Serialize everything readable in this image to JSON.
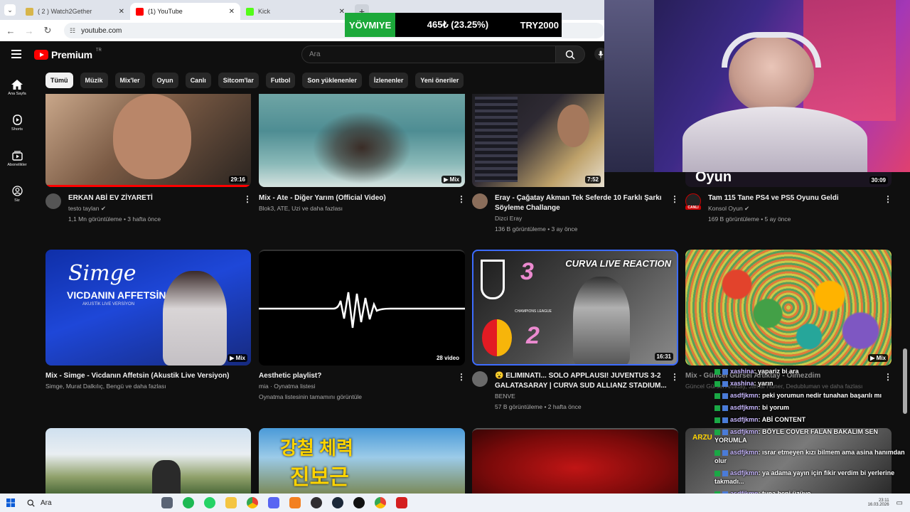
{
  "browser": {
    "tabs": [
      {
        "title": "( 2 ) Watch2Gether",
        "color": "#d7b54a",
        "active": false
      },
      {
        "title": "(1) YouTube",
        "color": "#ff0000",
        "active": true
      },
      {
        "title": "Kick",
        "color": "#53fc18",
        "active": false
      }
    ],
    "address": "youtube.com"
  },
  "ticker": {
    "label": "YÖVMIYE",
    "value": "465₺ (23.25%)",
    "currency": "TRY2000"
  },
  "youtube": {
    "logo_text": "Premium",
    "logo_region": "TR",
    "search_placeholder": "Ara",
    "leftnav": [
      {
        "label": "Ana Sayfa",
        "icon": "home-icon"
      },
      {
        "label": "Shorts",
        "icon": "shorts-icon"
      },
      {
        "label": "Abonelikler",
        "icon": "subscriptions-icon"
      },
      {
        "label": "Siz",
        "icon": "you-icon"
      }
    ],
    "chips": [
      "Tümü",
      "Müzik",
      "Mix'ler",
      "Oyun",
      "Canlı",
      "Sitcom'lar",
      "Futbol",
      "Son yüklenenler",
      "İzlenenler",
      "Yeni öneriler"
    ],
    "videos": [
      {
        "title": "ERKAN ABİ EV ZİYARETİ",
        "title2": "",
        "channel": "testo taylan",
        "verified": true,
        "stats": "1,1 Mn görüntüleme • 3 hafta önce",
        "badge": "29:16"
      },
      {
        "title": "Mix - Ate - Diğer Yarım (Official Video)",
        "title2": "",
        "channel": "Blok3, ATE, Uzi ve daha fazlası",
        "verified": false,
        "stats": "",
        "badge": "▶ Mix"
      },
      {
        "title": "Eray - Çağatay Akman Tek Seferde 10 Farklı Şarkı",
        "title2": "Söyleme Challange",
        "channel": "Dizci Eray",
        "verified": false,
        "stats": "136 B görüntüleme • 3 ay önce",
        "badge": "7:52"
      },
      {
        "title": "Tam 115 Tane PS4 ve PS5 Oyunu Geldi",
        "title2": "",
        "channel": "Konsol Oyun",
        "verified": true,
        "stats": "169 B görüntüleme • 5 ay önce",
        "badge": "30:09"
      },
      {
        "title": "Mix - Simge - Vicdanın Affetsin (Akustik Live Versiyon)",
        "title2": "",
        "channel": "Simge, Murat Dalkılıç, Bengü ve daha fazlası",
        "verified": false,
        "stats": "",
        "badge": "▶ Mix"
      },
      {
        "title": "Aesthetic playlist?",
        "title2": "",
        "channel": "mia · Oynatma listesi",
        "verified": false,
        "stats": "Oynatma listesinin tamamını görüntüle",
        "badge": "28 video"
      },
      {
        "title": "😮 ELIMINATI... SOLO APPLAUSI! JUVENTUS 3-2",
        "title2": "GALATASARAY | CURVA SUD ALLIANZ STADIUM...",
        "channel": "BENVE",
        "verified": false,
        "stats": "57 B görüntüleme • 2 hafta önce",
        "badge": "16:31"
      },
      {
        "title": "Mix - Güncel Gürsel Artıktay - Ölmezdim",
        "title2": "",
        "channel": "Güncel Gürsel Artıktay, Jamal Hüner, Dedubluman ve daha fazlası",
        "verified": false,
        "stats": "",
        "badge": "▶ Mix"
      }
    ],
    "thumb_texts": {
      "simge_script": "Simge",
      "simge_title": "VICDANIN AFFETSİN",
      "simge_sub": "AKUSTİK LIVE VERSİYON",
      "curva": "CURVA LIVE REACTION",
      "score_top": "3",
      "score_bottom": "2",
      "champions": "CHAMPIONS LEAGUE",
      "oyun": "Oyun",
      "canli": "CANLI",
      "korean_line1": "강철 체력",
      "korean_line2": "진보근",
      "arzu": "ARZU"
    }
  },
  "chat": [
    {
      "user": "xashina",
      "msg": ": yapariz bi ara"
    },
    {
      "user": "xashina",
      "msg": ": yarın"
    },
    {
      "user": "asdfjkmn",
      "msg": ": peki yorumun nedir tunahan başarılı mı"
    },
    {
      "user": "asdfjkmn",
      "msg": ": bi yorum"
    },
    {
      "user": "asdfjkmn",
      "msg": ": ABİ CONTENT"
    },
    {
      "user": "asdfjkmn",
      "msg": ": BÖYLE COVER FALAN BAKALIM SEN YORUMLA"
    },
    {
      "user": "asdfjkmn",
      "msg": ": ısrar etmeyen kızı bilmem ama asina hanımdan olur"
    },
    {
      "user": "asdfjkmn",
      "msg": ": ya adama yayın için fikir verdim bi yerlerine takmadı..."
    },
    {
      "user": "asdfjkmn",
      "msg": ": tuna beni üzüyo"
    }
  ],
  "taskbar": {
    "search": "Ara",
    "time": "23:11",
    "date": "16.03.2026"
  }
}
